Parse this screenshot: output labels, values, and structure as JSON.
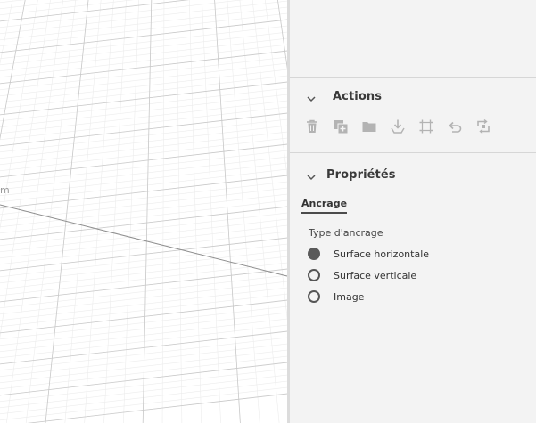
{
  "viewport": {
    "axis_label": "m"
  },
  "actions": {
    "title": "Actions",
    "tools": [
      {
        "icon": "trash-icon",
        "name": "delete"
      },
      {
        "icon": "duplicate-icon",
        "name": "duplicate"
      },
      {
        "icon": "folder-icon",
        "name": "group"
      },
      {
        "icon": "drop-to-surface-icon",
        "name": "drop"
      },
      {
        "icon": "fit-frame-icon",
        "name": "fit"
      },
      {
        "icon": "undo-icon",
        "name": "reset"
      },
      {
        "icon": "replace-icon",
        "name": "replace"
      }
    ]
  },
  "properties": {
    "title": "Propriétés",
    "tab": "Ancrage",
    "group_label": "Type d'ancrage",
    "options": [
      {
        "label": "Surface horizontale",
        "checked": true
      },
      {
        "label": "Surface verticale",
        "checked": false
      },
      {
        "label": "Image",
        "checked": false
      }
    ]
  },
  "colors": {
    "panel_bg": "#f3f3f3",
    "icon_gray": "#b3b3b3",
    "text_dark": "#3a3a3a"
  }
}
